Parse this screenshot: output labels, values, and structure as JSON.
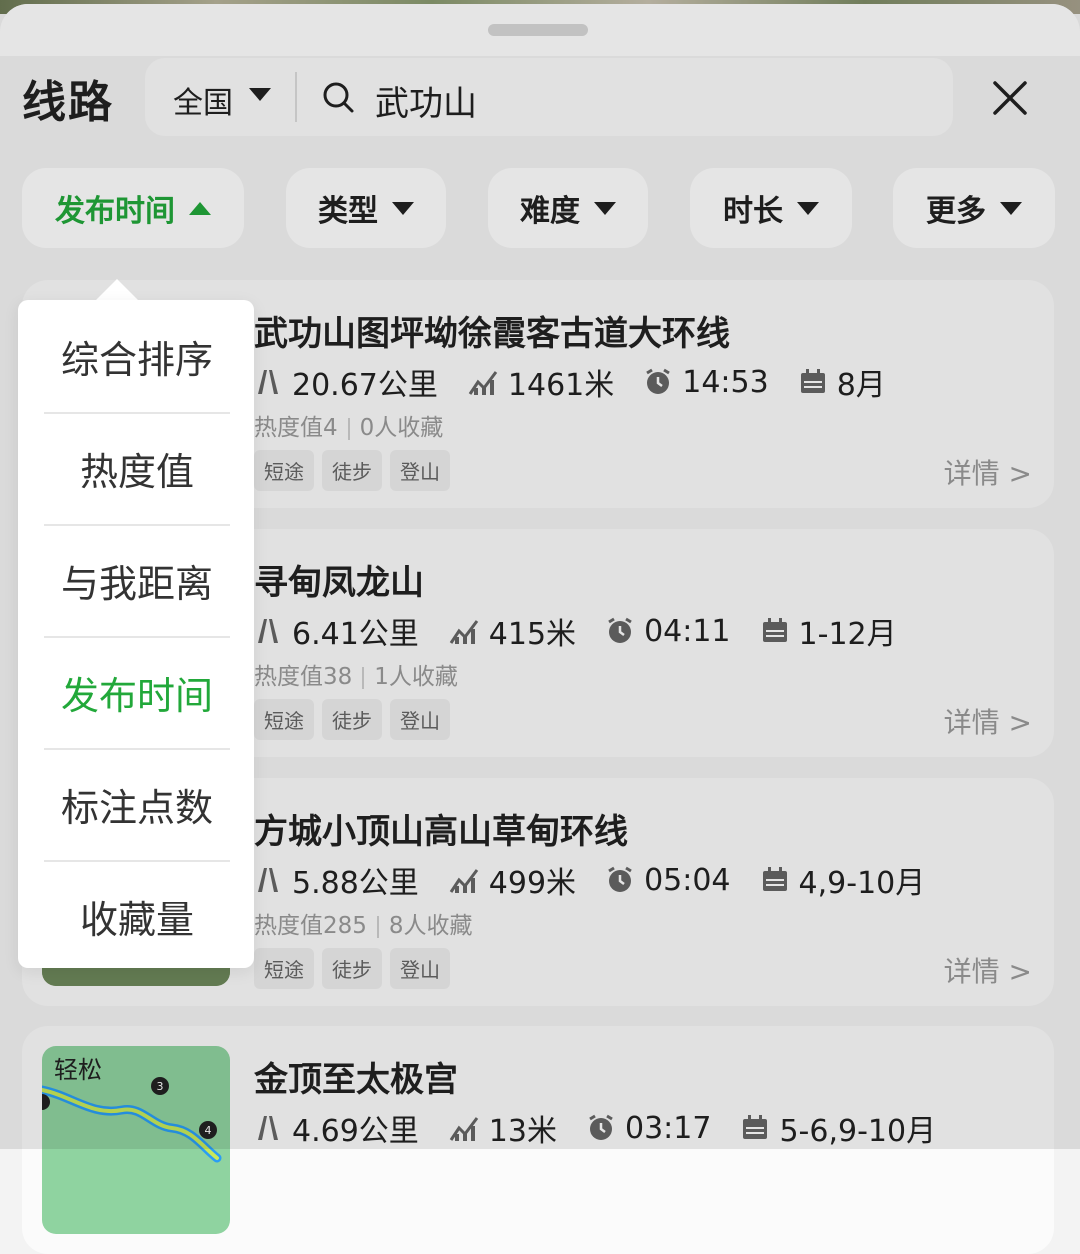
{
  "header": {
    "title": "线路",
    "region": "全国",
    "search_query": "武功山"
  },
  "filters": [
    {
      "label": "发布时间",
      "active": true
    },
    {
      "label": "类型",
      "active": false
    },
    {
      "label": "难度",
      "active": false
    },
    {
      "label": "时长",
      "active": false
    },
    {
      "label": "更多",
      "active": false
    }
  ],
  "sort_menu": {
    "items": [
      "综合排序",
      "热度值",
      "与我距离",
      "发布时间",
      "标注点数",
      "收藏量"
    ],
    "selected": "发布时间"
  },
  "routes": [
    {
      "name": "武功山图坪坳徐霞客古道大环线",
      "distance": "20.67公里",
      "elevation": "1461米",
      "duration": "14:53",
      "months": "8月",
      "heat": "热度值4",
      "favorites": "0人收藏",
      "tags": [
        "短途",
        "徒步",
        "登山"
      ],
      "detail": "详情 >"
    },
    {
      "name": "寻甸凤龙山",
      "distance": "6.41公里",
      "elevation": "415米",
      "duration": "04:11",
      "months": "1-12月",
      "heat": "热度值38",
      "favorites": "1人收藏",
      "tags": [
        "短途",
        "徒步",
        "登山"
      ],
      "detail": "详情 >"
    },
    {
      "name": "方城小顶山高山草甸环线",
      "distance": "5.88公里",
      "elevation": "499米",
      "duration": "05:04",
      "months": "4,9-10月",
      "heat": "热度值285",
      "favorites": "8人收藏",
      "tags": [
        "短途",
        "徒步",
        "登山"
      ],
      "detail": "详情 >"
    },
    {
      "name": "金顶至太极宫",
      "difficulty": "轻松",
      "distance": "4.69公里",
      "elevation": "13米",
      "duration": "03:17",
      "months": "5-6,9-10月",
      "heat": "",
      "favorites": "",
      "tags": [],
      "detail": ""
    }
  ],
  "colors": {
    "accent_green": "#22a83a",
    "text": "#222222",
    "muted": "#9a9a9a"
  }
}
